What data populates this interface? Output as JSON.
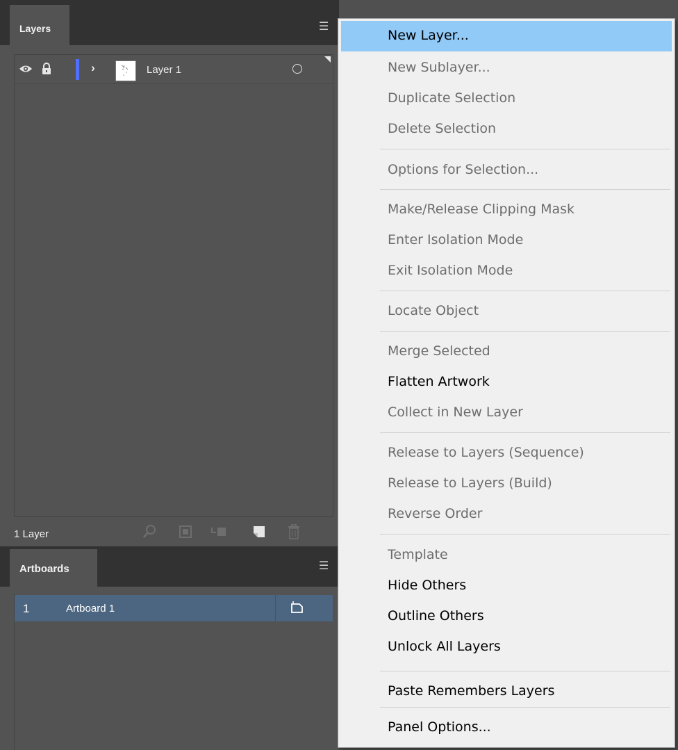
{
  "layers_panel": {
    "tab_label": "Layers",
    "layer_row": {
      "name": "Layer 1"
    },
    "footer": {
      "count_label": "1 Layer"
    }
  },
  "artboards_panel": {
    "tab_label": "Artboards",
    "rows": [
      {
        "number": "1",
        "name": "Artboard 1"
      }
    ]
  },
  "flyout_menu": {
    "items": [
      {
        "label": "New Layer...",
        "enabled": true,
        "highlighted": true
      },
      {
        "label": "New Sublayer...",
        "enabled": false
      },
      {
        "label": "Duplicate Selection",
        "enabled": false
      },
      {
        "label": "Delete Selection",
        "enabled": false
      },
      {
        "label": "Options for Selection...",
        "enabled": false
      },
      {
        "label": "Make/Release Clipping Mask",
        "enabled": false
      },
      {
        "label": "Enter Isolation Mode",
        "enabled": false
      },
      {
        "label": "Exit Isolation Mode",
        "enabled": false
      },
      {
        "label": "Locate Object",
        "enabled": false
      },
      {
        "label": "Merge Selected",
        "enabled": false
      },
      {
        "label": "Flatten Artwork",
        "enabled": true
      },
      {
        "label": "Collect in New Layer",
        "enabled": false
      },
      {
        "label": "Release to Layers (Sequence)",
        "enabled": false
      },
      {
        "label": "Release to Layers (Build)",
        "enabled": false
      },
      {
        "label": "Reverse Order",
        "enabled": false
      },
      {
        "label": "Template",
        "enabled": false
      },
      {
        "label": "Hide Others",
        "enabled": true
      },
      {
        "label": "Outline Others",
        "enabled": true
      },
      {
        "label": "Unlock All Layers",
        "enabled": true
      },
      {
        "label": "Paste Remembers Layers",
        "enabled": true
      },
      {
        "label": "Panel Options...",
        "enabled": true
      }
    ]
  },
  "colors": {
    "panel_bg": "#535353",
    "header_bg": "#323232",
    "layer_color": "#4f70ff",
    "artboard_selected": "#4c6580",
    "menu_bg": "#f0f0f0",
    "menu_highlight": "#91c9f7",
    "menu_disabled_text": "#6d6d6d"
  }
}
